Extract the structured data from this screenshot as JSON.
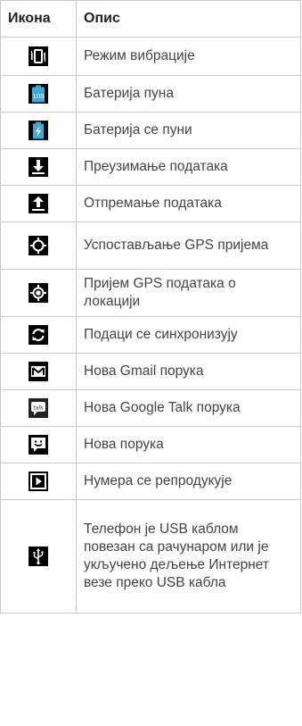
{
  "header": {
    "icon_col": "Икона",
    "desc_col": "Опис"
  },
  "rows": [
    {
      "icon": "vibrate-icon",
      "desc": "Режим вибрације"
    },
    {
      "icon": "battery-full-icon",
      "desc": "Батерија пуна",
      "badge": "100"
    },
    {
      "icon": "battery-charging-icon",
      "desc": "Батерија се пуни"
    },
    {
      "icon": "download-icon",
      "desc": "Преузимање података"
    },
    {
      "icon": "upload-icon",
      "desc": "Отпремање података"
    },
    {
      "icon": "gps-acquiring-icon",
      "desc": "Успостављање GPS пријема"
    },
    {
      "icon": "gps-on-icon",
      "desc": "Пријем GPS података о локацији"
    },
    {
      "icon": "sync-icon",
      "desc": "Подаци се синхронизују"
    },
    {
      "icon": "gmail-icon",
      "desc": "Нова Gmail порука"
    },
    {
      "icon": "google-talk-icon",
      "desc": "Нова Google Talk порука",
      "badge": "talk"
    },
    {
      "icon": "message-icon",
      "desc": "Нова порука"
    },
    {
      "icon": "music-playing-icon",
      "desc": "Нумера се репродукује"
    },
    {
      "icon": "usb-icon",
      "desc": "Телефон је USB каблом повезан са рачунаром или је укључено дељење Интернет везе преко USB кабла"
    }
  ],
  "colors": {
    "border": "#c8c8c8",
    "icon_bg": "#000000",
    "battery_blue": "#3fa9d8"
  }
}
